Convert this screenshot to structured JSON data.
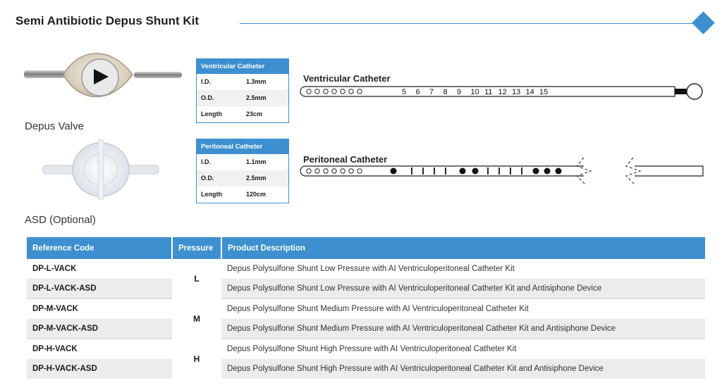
{
  "page": {
    "title": "Semi Antibiotic Depus Shunt Kit",
    "accent_color": "#3d8fd0"
  },
  "components": {
    "valve_caption": "Depus Valve",
    "asd_caption": "ASD (Optional)"
  },
  "spec_tables": [
    {
      "header": "Ventricular Catheter",
      "rows": [
        {
          "label": "I.D.",
          "value": "1.3mm"
        },
        {
          "label": "O.D.",
          "value": "2.5mm"
        },
        {
          "label": "Length",
          "value": "23cm"
        }
      ]
    },
    {
      "header": "Peritoneal Catheter",
      "rows": [
        {
          "label": "I.D.",
          "value": "1.1mm"
        },
        {
          "label": "O.D.",
          "value": "2.5mm"
        },
        {
          "label": "Length",
          "value": "120cm"
        }
      ]
    }
  ],
  "diagrams": {
    "ventricular_label": "Ventricular Catheter",
    "ventricular_markings": [
      "5",
      "6",
      "7",
      "8",
      "9",
      "10",
      "11",
      "12",
      "13",
      "14",
      "15"
    ],
    "peritoneal_label": "Peritoneal Catheter"
  },
  "product_table": {
    "headers": [
      "Reference Code",
      "Pressure",
      "Product Description"
    ],
    "groups": [
      {
        "pressure": "L",
        "rows": [
          {
            "code": "DP-L-VACK",
            "description": "Depus Polysulfone Shunt Low Pressure with AI Ventriculoperitoneal Catheter Kit"
          },
          {
            "code": "DP-L-VACK-ASD",
            "description": "Depus Polysulfone Shunt Low Pressure with AI Ventriculoperitoneal Catheter Kit and Antisiphone Device"
          }
        ]
      },
      {
        "pressure": "M",
        "rows": [
          {
            "code": "DP-M-VACK",
            "description": "Depus Polysulfone Shunt Medium Pressure with AI Ventriculoperitoneal Catheter Kit"
          },
          {
            "code": "DP-M-VACK-ASD",
            "description": "Depus Polysulfone Shunt Medium Pressure with AI Ventriculoperitoneal Catheter Kit and Antisiphone Device"
          }
        ]
      },
      {
        "pressure": "H",
        "rows": [
          {
            "code": "DP-H-VACK",
            "description": "Depus Polysulfone Shunt High Pressure with AI Ventriculoperitoneal Catheter Kit"
          },
          {
            "code": "DP-H-VACK-ASD",
            "description": "Depus Polysulfone Shunt High Pressure with AI Ventriculoperitoneal Catheter Kit and Antisiphone Device"
          }
        ]
      }
    ]
  }
}
